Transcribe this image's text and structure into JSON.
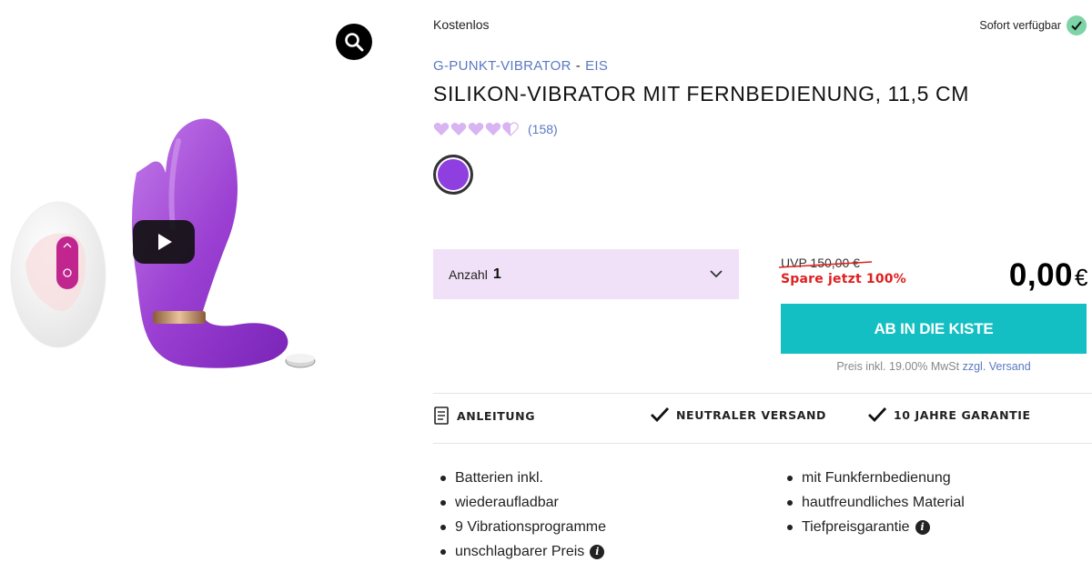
{
  "media": {
    "zoom_icon": "magnifier-icon",
    "play_icon": "play-icon"
  },
  "product": {
    "price_label": "Kostenlos",
    "availability": "Sofort verfügbar",
    "breadcrumb": [
      {
        "label": "G-PUNKT-VIBRATOR"
      },
      {
        "label": "EIS"
      }
    ],
    "breadcrumb_sep": "-",
    "title": "SILIKON-VIBRATOR MIT FERNBEDIENUNG, 11,5 CM",
    "rating": 4.5,
    "rating_max": 5,
    "reviews": "(158)",
    "color_swatch": "#8f3fe0"
  },
  "purchase": {
    "qty_label": "Anzahl",
    "qty_value": "1",
    "uvp": "UVP 150,00 €",
    "save": "Spare jetzt 100%",
    "price": "0,00",
    "currency": "€",
    "cart_button": "AB IN DIE KISTE",
    "tax_prefix": "Preis inkl. 19.00% MwSt",
    "tax_link": "zzgl. Versand"
  },
  "features": [
    {
      "label": "ANLEITUNG",
      "icon": "document-icon"
    },
    {
      "label": "NEUTRALER VERSAND",
      "icon": "checkmark-icon"
    },
    {
      "label": "10 JAHRE GARANTIE",
      "icon": "checkmark-icon"
    }
  ],
  "bullets_left": [
    {
      "text": "Batterien inkl.",
      "info": false
    },
    {
      "text": "wiederaufladbar",
      "info": false
    },
    {
      "text": "9 Vibrationsprogramme",
      "info": false
    },
    {
      "text": "unschlagbarer Preis",
      "info": true
    }
  ],
  "bullets_right": [
    {
      "text": "mit Funkfernbedienung",
      "info": false
    },
    {
      "text": "hautfreundliches Material",
      "info": false
    },
    {
      "text": "Tiefpreisgarantie",
      "info": true
    }
  ],
  "colors": {
    "accent_teal": "#13bfc2",
    "link_blue": "#5a79c2",
    "sale_red": "#e02020",
    "qty_bg": "#f0e1f8",
    "heart_purple": "#d8b4f2"
  }
}
